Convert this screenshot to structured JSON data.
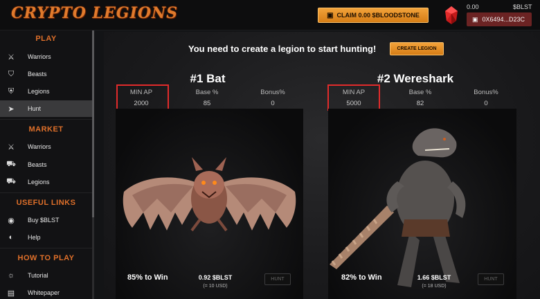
{
  "app": {
    "logo": "CRYPTO LEGIONS"
  },
  "header": {
    "claim_label": "CLAIM 0.00 $BLOODSTONE",
    "wallet_balance": "0.00",
    "wallet_unit": "$BLST",
    "wallet_address": "0X6494...D23C"
  },
  "sidebar": {
    "sections": [
      {
        "title": "PLAY",
        "items": [
          {
            "label": "Warriors",
            "icon": "sword-icon"
          },
          {
            "label": "Beasts",
            "icon": "shield-icon"
          },
          {
            "label": "Legions",
            "icon": "legion-shield-icon"
          },
          {
            "label": "Hunt",
            "icon": "hunt-icon",
            "active": true
          }
        ]
      },
      {
        "title": "MARKET",
        "items": [
          {
            "label": "Warriors",
            "icon": "market-sword-icon"
          },
          {
            "label": "Beasts",
            "icon": "market-beast-icon"
          },
          {
            "label": "Legions",
            "icon": "market-legion-icon"
          }
        ]
      },
      {
        "title": "USEFUL LINKS",
        "items": [
          {
            "label": "Buy $BLST",
            "icon": "coin-icon"
          },
          {
            "label": "Help",
            "icon": "help-icon"
          }
        ]
      },
      {
        "title": "HOW TO PLAY",
        "items": [
          {
            "label": "Tutorial",
            "icon": "bulb-icon"
          },
          {
            "label": "Whitepaper",
            "icon": "document-icon"
          }
        ]
      }
    ]
  },
  "main": {
    "banner": "You need to create a legion to start hunting!",
    "create_legion_label": "CREATE LEGION",
    "monsters": [
      {
        "title": "#1 Bat",
        "min_ap_label": "MIN AP",
        "min_ap": "2000",
        "base_label": "Base %",
        "base": "85",
        "bonus_label": "Bonus%",
        "bonus": "0",
        "win_text": "85% to Win",
        "reward": "0.92 $BLST",
        "reward_usd": "(= 10 USD)",
        "hunt_label": "HUNT"
      },
      {
        "title": "#2 Wereshark",
        "min_ap_label": "MIN AP",
        "min_ap": "5000",
        "base_label": "Base %",
        "base": "82",
        "bonus_label": "Bonus%",
        "bonus": "0",
        "win_text": "82% to Win",
        "reward": "1.66 $BLST",
        "reward_usd": "(= 18 USD)",
        "hunt_label": "HUNT"
      }
    ]
  },
  "colors": {
    "accent": "#e0702a",
    "button": "#e8902a",
    "wallet": "#6b2323",
    "highlight": "#e22b2b"
  }
}
